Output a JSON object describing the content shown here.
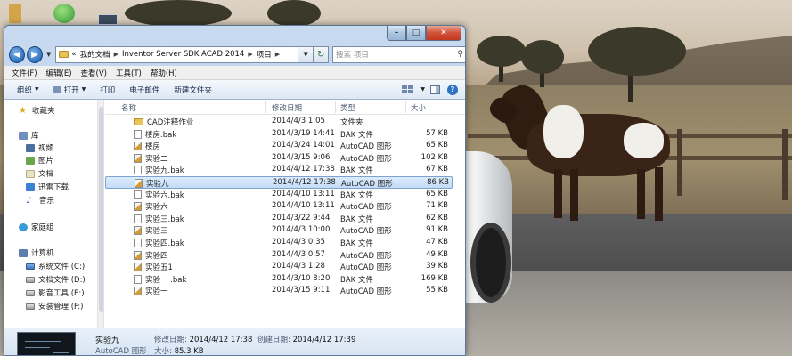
{
  "window": {
    "caption": {
      "minimize": "–",
      "maximize": "□",
      "close": "✕"
    }
  },
  "navbar": {
    "back_icon": "back-arrow-icon",
    "forward_icon": "forward-arrow-icon",
    "address": {
      "overflow": "«",
      "segments": [
        "我的文档",
        "Inventor Server SDK ACAD 2014",
        "项目"
      ]
    },
    "search": {
      "placeholder": "搜索 项目"
    }
  },
  "menu": [
    "文件(F)",
    "编辑(E)",
    "查看(V)",
    "工具(T)",
    "帮助(H)"
  ],
  "toolbar": {
    "organize": "组织",
    "open": "打开",
    "print": "打印",
    "email": "电子邮件",
    "new_folder": "新建文件夹"
  },
  "sidebar": {
    "favorites": "收藏夹",
    "library": "库",
    "library_items": [
      "视频",
      "图片",
      "文档",
      "迅雷下载",
      "音乐"
    ],
    "homegroup": "家庭组",
    "computer": "计算机",
    "drives": [
      "系统文件 (C:)",
      "文档文件 (D:)",
      "影音工具 (E:)",
      "安装管理 (F:)"
    ]
  },
  "columns": {
    "name": "名称",
    "date": "修改日期",
    "type": "类型",
    "size": "大小"
  },
  "files": [
    {
      "name": "CAD注释作业",
      "date": "2014/4/3 1:05",
      "type": "文件夹",
      "size": "",
      "kind": "folder"
    },
    {
      "name": "楼房.bak",
      "date": "2014/3/19 14:41",
      "type": "BAK 文件",
      "size": "57 KB",
      "kind": "bak"
    },
    {
      "name": "楼房",
      "date": "2014/3/24 14:01",
      "type": "AutoCAD 图形",
      "size": "65 KB",
      "kind": "dwg"
    },
    {
      "name": "实验二",
      "date": "2014/3/15 9:06",
      "type": "AutoCAD 图形",
      "size": "102 KB",
      "kind": "dwg"
    },
    {
      "name": "实验九.bak",
      "date": "2014/4/12 17:38",
      "type": "BAK 文件",
      "size": "67 KB",
      "kind": "bak"
    },
    {
      "name": "实验九",
      "date": "2014/4/12 17:38",
      "type": "AutoCAD 图形",
      "size": "86 KB",
      "kind": "dwg",
      "selected": true
    },
    {
      "name": "实验六.bak",
      "date": "2014/4/10 13:11",
      "type": "BAK 文件",
      "size": "65 KB",
      "kind": "bak"
    },
    {
      "name": "实验六",
      "date": "2014/4/10 13:11",
      "type": "AutoCAD 图形",
      "size": "71 KB",
      "kind": "dwg"
    },
    {
      "name": "实验三.bak",
      "date": "2014/3/22 9:44",
      "type": "BAK 文件",
      "size": "62 KB",
      "kind": "bak"
    },
    {
      "name": "实验三",
      "date": "2014/4/3 10:00",
      "type": "AutoCAD 图形",
      "size": "91 KB",
      "kind": "dwg"
    },
    {
      "name": "实验四.bak",
      "date": "2014/4/3 0:35",
      "type": "BAK 文件",
      "size": "47 KB",
      "kind": "bak"
    },
    {
      "name": "实验四",
      "date": "2014/4/3 0:57",
      "type": "AutoCAD 图形",
      "size": "49 KB",
      "kind": "dwg"
    },
    {
      "name": "实验五1",
      "date": "2014/4/3 1:28",
      "type": "AutoCAD 图形",
      "size": "39 KB",
      "kind": "dwg"
    },
    {
      "name": "实验一 .bak",
      "date": "2014/3/10 8:20",
      "type": "BAK 文件",
      "size": "169 KB",
      "kind": "bak"
    },
    {
      "name": "实验一",
      "date": "2014/3/15 9:11",
      "type": "AutoCAD 图形",
      "size": "55 KB",
      "kind": "dwg"
    }
  ],
  "details": {
    "name": "实验九",
    "type": "AutoCAD 图形",
    "modified_label": "修改日期:",
    "modified": "2014/4/12 17:38",
    "created_label": "创建日期:",
    "created": "2014/4/12 17:39",
    "size_label": "大小:",
    "size": "85.3 KB"
  }
}
